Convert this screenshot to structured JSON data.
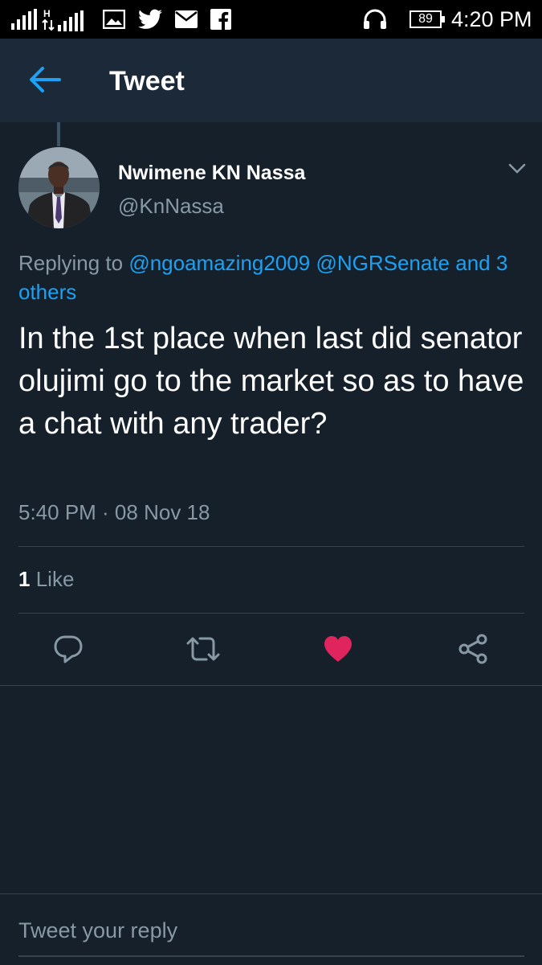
{
  "status_bar": {
    "time": "4:20 PM",
    "battery": "89",
    "icons": [
      "signal-icon",
      "hspa-signal-icon",
      "gallery-icon",
      "twitter-icon",
      "mail-icon",
      "facebook-icon",
      "headphones-icon",
      "battery-icon"
    ]
  },
  "header": {
    "title": "Tweet",
    "back_icon": "arrow-left-icon"
  },
  "tweet": {
    "author_name": "Nwimene KN Nassa",
    "author_handle": "@KnNassa",
    "replying_prefix": "Replying to",
    "replying_mentions": [
      "@ngoamazing2009",
      "@NGRSenate"
    ],
    "replying_suffix": "and 3 others",
    "text": "In the 1st place when last did senator olujimi go to the market so as to have a chat with any trader?",
    "timestamp": "5:40 PM · 08 Nov 18",
    "like_count": "1",
    "like_label": "Like"
  },
  "actions": {
    "icons": [
      "reply-icon",
      "retweet-icon",
      "heart-icon",
      "share-icon"
    ],
    "liked_color": "#e0245e"
  },
  "reply_bar": {
    "placeholder": "Tweet your reply"
  },
  "colors": {
    "background": "#15202b",
    "header_bg": "#1c2938",
    "accent": "#1da1f2",
    "secondary_text": "#8899a6",
    "divider": "#38444d"
  }
}
